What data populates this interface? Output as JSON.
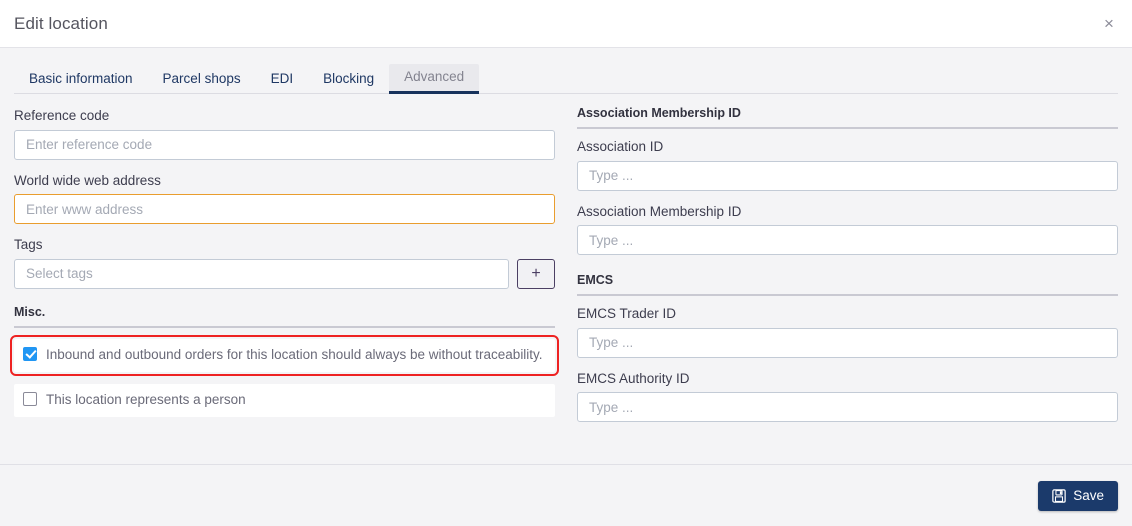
{
  "header": {
    "title": "Edit location",
    "close_label": "×"
  },
  "tabs": [
    {
      "label": "Basic information",
      "active": false
    },
    {
      "label": "Parcel shops",
      "active": false
    },
    {
      "label": "EDI",
      "active": false
    },
    {
      "label": "Blocking",
      "active": false
    },
    {
      "label": "Advanced",
      "active": true
    }
  ],
  "left": {
    "reference_code": {
      "label": "Reference code",
      "placeholder": "Enter reference code",
      "value": ""
    },
    "web_address": {
      "label": "World wide web address",
      "placeholder": "Enter www address",
      "value": "",
      "state": "warning",
      "border_color": "#e99d2e"
    },
    "tags": {
      "label": "Tags",
      "placeholder": "Select tags",
      "value": "",
      "add_label": "+"
    },
    "misc": {
      "heading": "Misc.",
      "checkboxes": [
        {
          "label": "Inbound and outbound orders for this location should always be without traceability.",
          "checked": true,
          "highlighted": true
        },
        {
          "label": "This location represents a person",
          "checked": false,
          "highlighted": false
        }
      ]
    }
  },
  "right": {
    "association": {
      "heading": "Association Membership ID",
      "fields": [
        {
          "label": "Association ID",
          "placeholder": "Type ...",
          "value": ""
        },
        {
          "label": "Association Membership ID",
          "placeholder": "Type ...",
          "value": ""
        }
      ]
    },
    "emcs": {
      "heading": "EMCS",
      "fields": [
        {
          "label": "EMCS Trader ID",
          "placeholder": "Type ...",
          "value": ""
        },
        {
          "label": "EMCS Authority ID",
          "placeholder": "Type ...",
          "value": ""
        }
      ]
    }
  },
  "footer": {
    "save_label": "Save",
    "save_icon": "floppy-disk-icon",
    "accent_color": "#1b3a6b"
  },
  "annotation": {
    "color": "#ee2222",
    "target": "traceability-checkbox-row"
  }
}
